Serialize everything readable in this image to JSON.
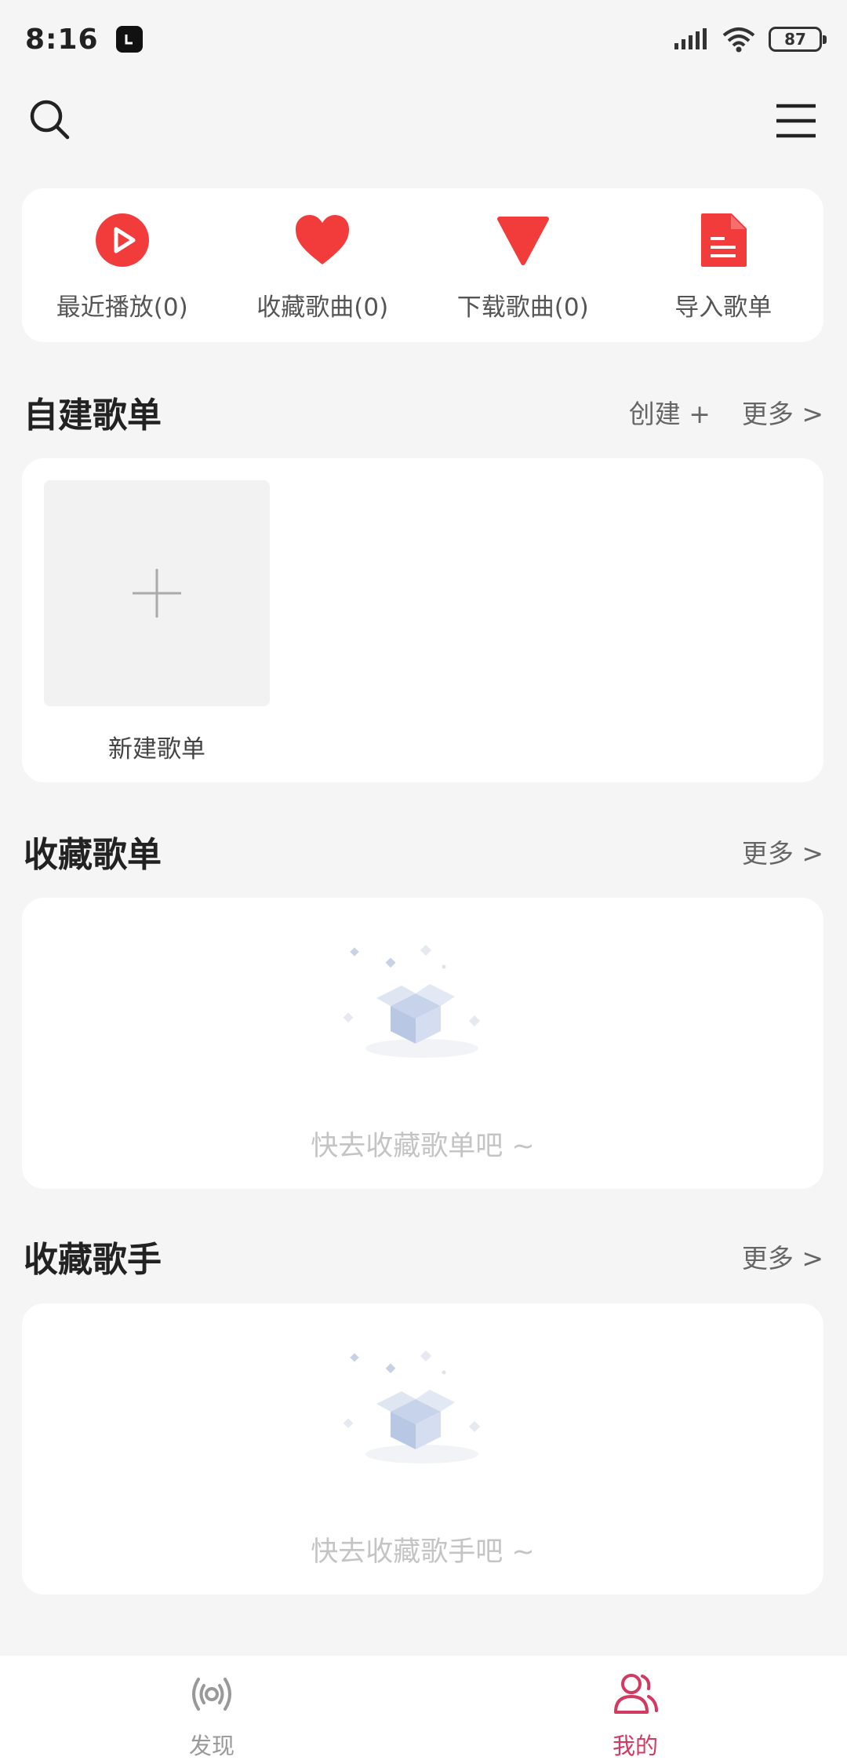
{
  "status_bar": {
    "time": "8:16",
    "battery": "87"
  },
  "quick_actions": [
    {
      "label": "最近播放(0)",
      "icon": "play-circle-icon"
    },
    {
      "label": "收藏歌曲(0)",
      "icon": "heart-icon"
    },
    {
      "label": "下载歌曲(0)",
      "icon": "download-triangle-icon"
    },
    {
      "label": "导入歌单",
      "icon": "document-icon"
    }
  ],
  "sections": {
    "my_playlists": {
      "title": "自建歌单",
      "create": "创建 +",
      "more": "更多 >",
      "new_playlist": "新建歌单"
    },
    "fav_playlists": {
      "title": "收藏歌单",
      "more": "更多 >",
      "empty": "快去收藏歌单吧 ~"
    },
    "fav_singers": {
      "title": "收藏歌手",
      "more": "更多 >",
      "empty": "快去收藏歌手吧 ~"
    }
  },
  "bottom_nav": [
    {
      "label": "发现",
      "icon": "broadcast-icon",
      "active": false
    },
    {
      "label": "我的",
      "icon": "users-icon",
      "active": true
    }
  ],
  "colors": {
    "accent": "#f23c3c",
    "nav_active": "#d23a62",
    "background": "#f5f5f5"
  }
}
